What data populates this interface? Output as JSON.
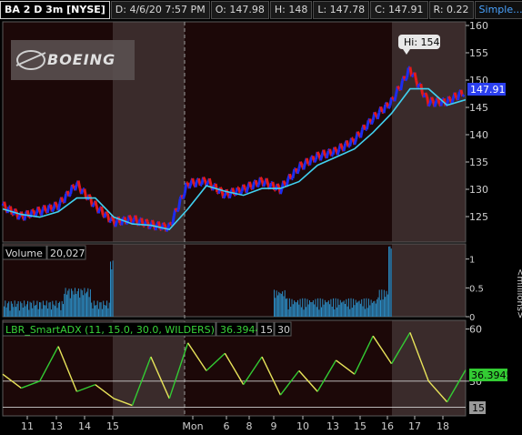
{
  "header": {
    "symbol": "BA 2 D 3m [NYSE]",
    "date": "D: 4/6/20 7:57 PM",
    "open": "O: 147.98",
    "high": "H: 148",
    "low": "L: 147.78",
    "close": "C: 147.91",
    "range": "R: 0.22",
    "studies_link": "Simple...",
    "icon": "expand-icon"
  },
  "logo": {
    "text": "BOEING"
  },
  "price_panel": {
    "hi_label": "Hi: 154",
    "last_price_label": "147.91",
    "y_ticks": [
      "160",
      "155",
      "150",
      "145",
      "140",
      "135",
      "130",
      "125"
    ]
  },
  "volume_panel": {
    "title": "Volume",
    "value": "20,027",
    "y_ticks": [
      "1",
      "0.5",
      "0"
    ],
    "units": "<millions>"
  },
  "adx_panel": {
    "title": "LBR_SmartADX (11, 15.0, 30.0, WILDERS)",
    "value": "36.3944",
    "param1": "15",
    "param2": "30",
    "y_ticks": [
      "60",
      "30"
    ],
    "right_value": "36.3945",
    "right_low": "15"
  },
  "x_ticks": [
    "11",
    "13",
    "14",
    "15",
    "Mon",
    "6",
    "8",
    "9",
    "10",
    "13",
    "15",
    "16",
    "17",
    "18"
  ],
  "colors": {
    "up": "#1d2df0",
    "down": "#e21a1a",
    "average": "#40d0f0",
    "volume": "#2b8cc4",
    "adx_rising": "#33cc33",
    "adx_falling": "#e8e35a",
    "session_bg": "#3a2b2b",
    "pre_bg": "#1c0808"
  },
  "chart_data": [
    {
      "type": "line",
      "title": "BA 2 D 3m [NYSE]",
      "series": [
        {
          "name": "",
          "x": [
            0,
            4,
            8,
            12,
            16,
            20,
            24,
            28,
            32,
            36,
            40,
            44,
            48,
            52,
            56,
            60,
            64,
            68,
            72,
            76,
            80,
            84,
            88,
            92,
            96,
            100
          ],
          "values": [
            127,
            125,
            126,
            127,
            131,
            127,
            124,
            124.5,
            123.5,
            123,
            131,
            131.5,
            129,
            130,
            131.5,
            130,
            134,
            136,
            137,
            139,
            143,
            146,
            152,
            146,
            146,
            148
          ]
        }
      ],
      "ylim": [
        121,
        160
      ]
    },
    {
      "type": "bar",
      "title": "Volume",
      "ylabel": "<millions>",
      "ylim": [
        0,
        1.2
      ]
    },
    {
      "type": "line",
      "title": "LBR_SmartADX (11, 15.0, 30.0, WILDERS)",
      "series": [
        {
          "name": "",
          "x": [
            0,
            4,
            8,
            12,
            16,
            20,
            24,
            28,
            32,
            36,
            40,
            44,
            48,
            52,
            56,
            60,
            64,
            68,
            72,
            76,
            80,
            84,
            88,
            92,
            96,
            100
          ],
          "values": [
            34,
            26,
            30,
            50,
            24,
            28,
            20,
            16,
            44,
            20,
            52,
            36,
            46,
            28,
            44,
            22,
            36,
            24,
            42,
            34,
            56,
            40,
            58,
            30,
            18,
            36.39
          ]
        }
      ],
      "ylim": [
        10,
        65
      ]
    }
  ]
}
